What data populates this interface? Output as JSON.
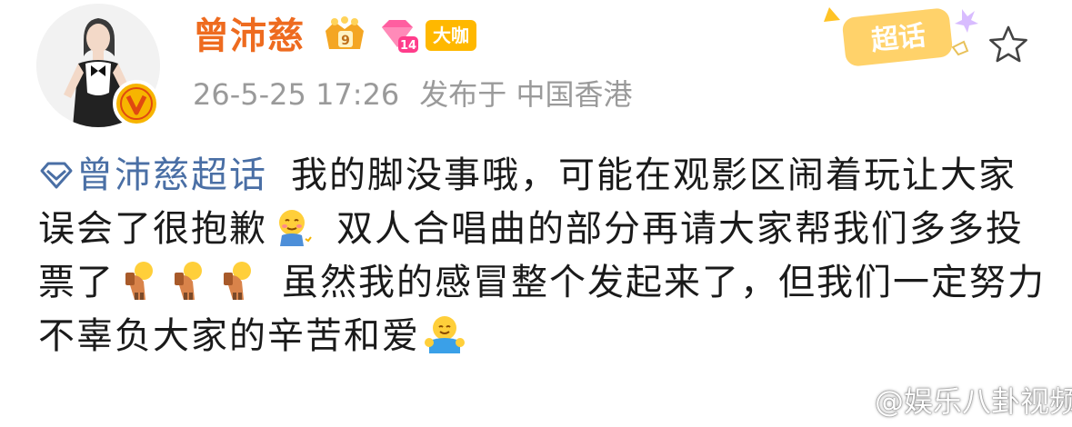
{
  "post": {
    "author_name": "曾沛慈",
    "badges": {
      "crown_level": "9",
      "gem_level": "14",
      "daka_label": "大咖"
    },
    "timestamp": "26-5-25 17:26",
    "location": "发布于 中国香港",
    "supertopic_chip_label": "超话",
    "content": {
      "topic_link": "曾沛慈超话",
      "seg1": "我的脚没事哦，可能在观影区闹着玩让大家误会了很抱歉",
      "seg2": "双人合唱曲的部分再请大家帮我们多多投票了",
      "seg3": "虽然我的感冒整个发起来了，但我们一定努力不辜负大家的辛苦和爱"
    }
  },
  "watermark": {
    "text": "@娱乐八卦视频"
  },
  "colors": {
    "author": "#ee6b1f",
    "meta": "#9a9a9a",
    "topic": "#4a6fa5",
    "verified": "#f7b500",
    "daka": "#ffb800"
  },
  "icons": [
    "avatar",
    "verified-v-icon",
    "crown-badge-icon",
    "gem-badge-icon",
    "supertopic-icon",
    "star-icon",
    "diamond-icon",
    "blush-emoji",
    "bow-emoji",
    "hug-emoji",
    "weibo-icon"
  ]
}
